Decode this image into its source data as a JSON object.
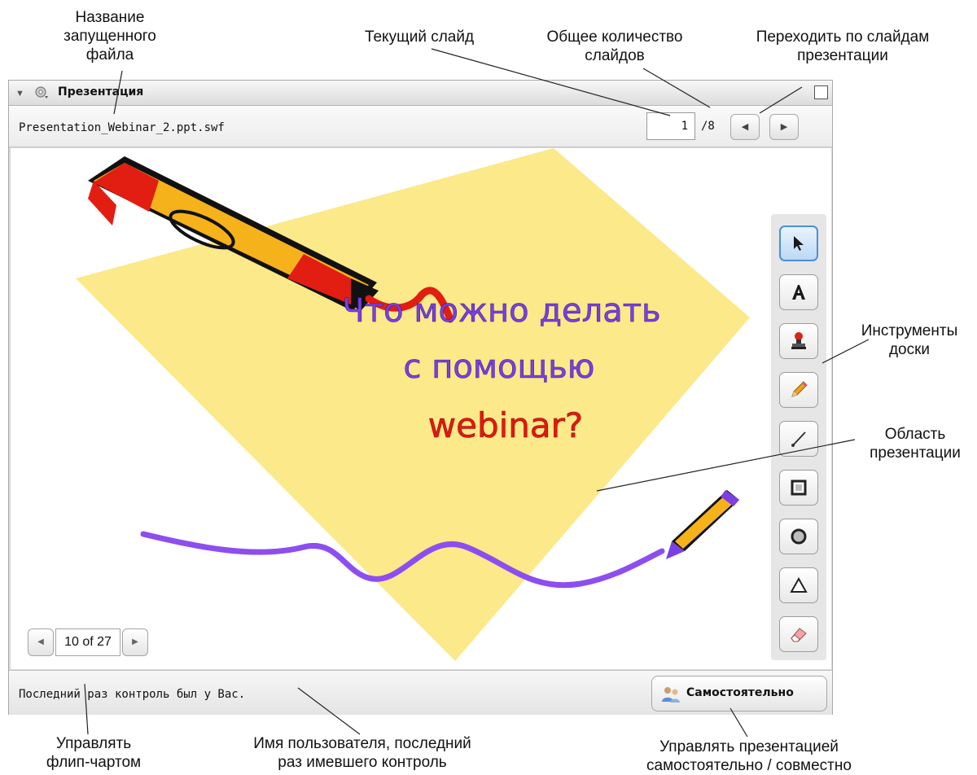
{
  "callouts": {
    "file_name": "Название\nзапущенного\nфайла",
    "current_slide": "Текущий слайд",
    "total_slides": "Общее количество\nслайдов",
    "navigate_slides": "Переходить по слайдам\nпрезентации",
    "board_tools": "Инструменты\nдоски",
    "presentation_area": "Область\nпрезентации",
    "flipchart": "Управлять\nфлип-чартом",
    "last_user": "Имя пользователя, последний\nраз имевшего контроль",
    "self_control": "Управлять презентацией\nсамостоятельно / совместно"
  },
  "panel": {
    "title": "Презентация",
    "file_name": "Presentation_Webinar_2.ppt.swf",
    "current_slide": "1",
    "total_slides": "/8",
    "prev_icon": "triangle-left-icon",
    "next_icon": "triangle-right-icon"
  },
  "slide": {
    "line1": "Что можно делать",
    "line2": "с помощью",
    "line3": "webinar?",
    "text_color": "#7b3fe4",
    "accent_color": "#e8170f",
    "background_shape_color": "#fbe98a",
    "curve_color": "#8d4ef0"
  },
  "tools": [
    {
      "name": "pointer",
      "icon": "cursor-arrow-icon",
      "active": true
    },
    {
      "name": "text",
      "icon": "letter-a-icon",
      "active": false
    },
    {
      "name": "stamp",
      "icon": "stamp-icon",
      "active": false
    },
    {
      "name": "pencil",
      "icon": "pencil-icon",
      "active": false
    },
    {
      "name": "line",
      "icon": "line-icon",
      "active": false
    },
    {
      "name": "rectangle",
      "icon": "square-icon",
      "active": false
    },
    {
      "name": "ellipse",
      "icon": "circle-icon",
      "active": false
    },
    {
      "name": "triangle",
      "icon": "triangle-icon",
      "active": false
    },
    {
      "name": "eraser",
      "icon": "eraser-icon",
      "active": false
    }
  ],
  "flipchart": {
    "page": "10 of 27"
  },
  "status": {
    "text": "Последний раз контроль был у Вас.",
    "self_button": "Самостоятельно"
  }
}
